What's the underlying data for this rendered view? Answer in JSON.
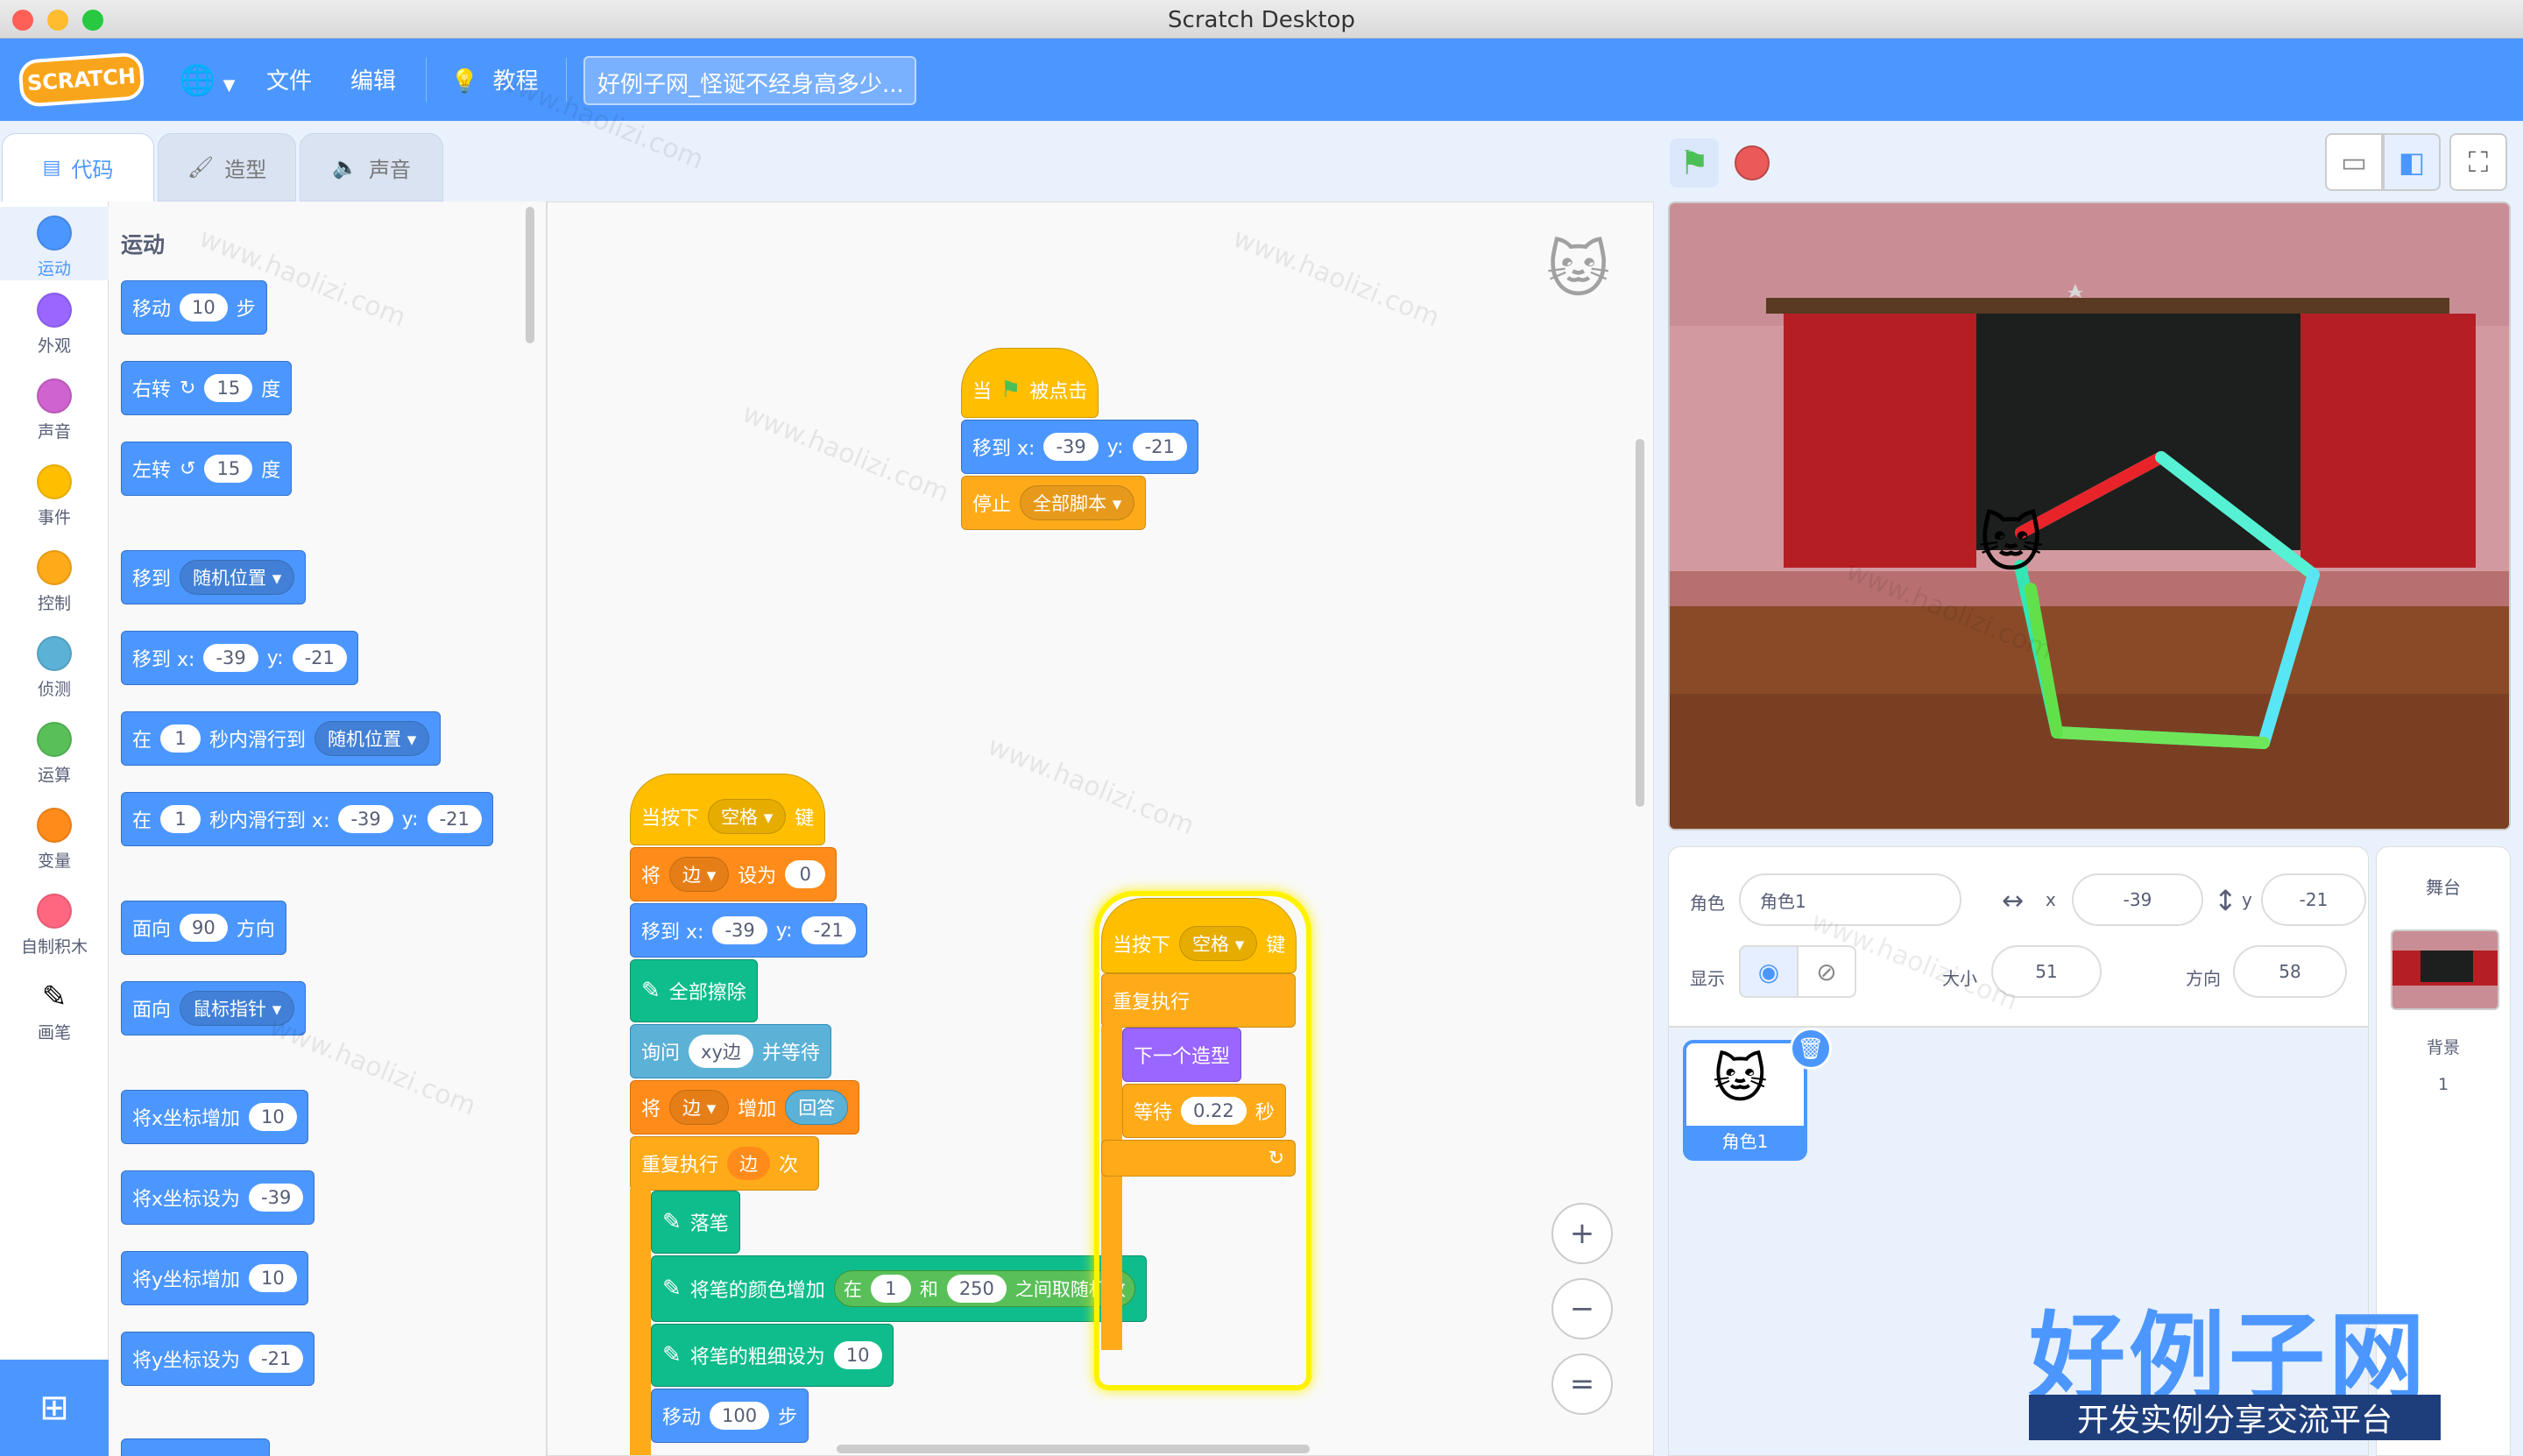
{
  "window": {
    "title": "Scratch Desktop"
  },
  "menubar": {
    "logo": "SCRATCH",
    "file": "文件",
    "edit": "编辑",
    "tutorials": "教程",
    "project_title": "好例子网_怪诞不经身高多少..."
  },
  "tabs": {
    "code": "代码",
    "costumes": "造型",
    "sounds": "声音"
  },
  "categories": [
    {
      "label": "运动",
      "color": "#4c97ff"
    },
    {
      "label": "外观",
      "color": "#9966ff"
    },
    {
      "label": "声音",
      "color": "#cf63cf"
    },
    {
      "label": "事件",
      "color": "#ffbf00"
    },
    {
      "label": "控制",
      "color": "#ffab19"
    },
    {
      "label": "侦测",
      "color": "#5cb1d6"
    },
    {
      "label": "运算",
      "color": "#59c059"
    },
    {
      "label": "变量",
      "color": "#ff8c1a"
    },
    {
      "label": "自制积木",
      "color": "#ff6680"
    },
    {
      "label": "画笔",
      "color": "#0fbd8c"
    }
  ],
  "flyout": {
    "heading": "运动",
    "move": {
      "a": "移动",
      "n": "10",
      "b": "步"
    },
    "turn_right": {
      "a": "右转",
      "n": "15",
      "b": "度"
    },
    "turn_left": {
      "a": "左转",
      "n": "15",
      "b": "度"
    },
    "goto": {
      "a": "移到",
      "dd": "随机位置"
    },
    "goto_xy": {
      "a": "移到 x:",
      "x": "-39",
      "y_label": "y:",
      "y": "-21"
    },
    "glide": {
      "a": "在",
      "n": "1",
      "b": "秒内滑行到",
      "dd": "随机位置"
    },
    "glide_xy": {
      "a": "在",
      "n": "1",
      "b": "秒内滑行到 x:",
      "x": "-39",
      "y_label": "y:",
      "y": "-21"
    },
    "point_dir": {
      "a": "面向",
      "n": "90",
      "b": "方向"
    },
    "point_towards": {
      "a": "面向",
      "dd": "鼠标指针"
    },
    "change_x": {
      "a": "将x坐标增加",
      "n": "10"
    },
    "set_x": {
      "a": "将x坐标设为",
      "n": "-39"
    },
    "change_y": {
      "a": "将y坐标增加",
      "n": "10"
    },
    "set_y": {
      "a": "将y坐标设为",
      "n": "-21"
    }
  },
  "scripts": {
    "s1": {
      "hat_a": "当",
      "hat_b": "被点击",
      "goto_a": "移到 x:",
      "goto_x": "-39",
      "goto_yl": "y:",
      "goto_y": "-21",
      "stop_a": "停止",
      "stop_dd": "全部脚本"
    },
    "s2": {
      "hat_a": "当按下",
      "hat_dd": "空格",
      "hat_b": "键",
      "set_a": "将",
      "set_dd": "边",
      "set_b": "设为",
      "set_n": "0",
      "goto_a": "移到 x:",
      "goto_x": "-39",
      "goto_yl": "y:",
      "goto_y": "-21",
      "erase": "全部擦除",
      "ask_a": "询问",
      "ask_n": "xy边",
      "ask_b": "并等待",
      "change_a": "将",
      "change_dd": "边",
      "change_b": "增加",
      "change_r": "回答",
      "repeat_a": "重复执行",
      "repeat_r": "边",
      "repeat_b": "次",
      "pendown": "落笔",
      "color_a": "将笔的颜色增加",
      "rand_a": "在",
      "rand_1": "1",
      "rand_and": "和",
      "rand_2": "250",
      "rand_b": "之间取随机数",
      "size_a": "将笔的粗细设为",
      "size_n": "10",
      "move_a": "移动",
      "move_n": "100",
      "move_b": "步"
    },
    "s3": {
      "hat_a": "当按下",
      "hat_dd": "空格",
      "hat_b": "键",
      "forever": "重复执行",
      "next": "下一个造型",
      "wait_a": "等待",
      "wait_n": "0.22",
      "wait_b": "秒"
    }
  },
  "zoom": {
    "in": "+",
    "out": "−",
    "reset": "="
  },
  "sprite_info": {
    "sprite_label": "角色",
    "sprite_name": "角色1",
    "x_label": "x",
    "x": "-39",
    "y_label": "y",
    "y": "-21",
    "show_label": "显示",
    "size_label": "大小",
    "size": "51",
    "dir_label": "方向",
    "dir": "58"
  },
  "sprites": [
    {
      "name": "角色1"
    }
  ],
  "stage_pane": {
    "title": "舞台",
    "backdrops_label": "背景",
    "backdrops_count": "1"
  },
  "watermark": {
    "main": "好例子网",
    "sub": "开发实例分享交流平台",
    "diag": "www.haolizi.com"
  }
}
